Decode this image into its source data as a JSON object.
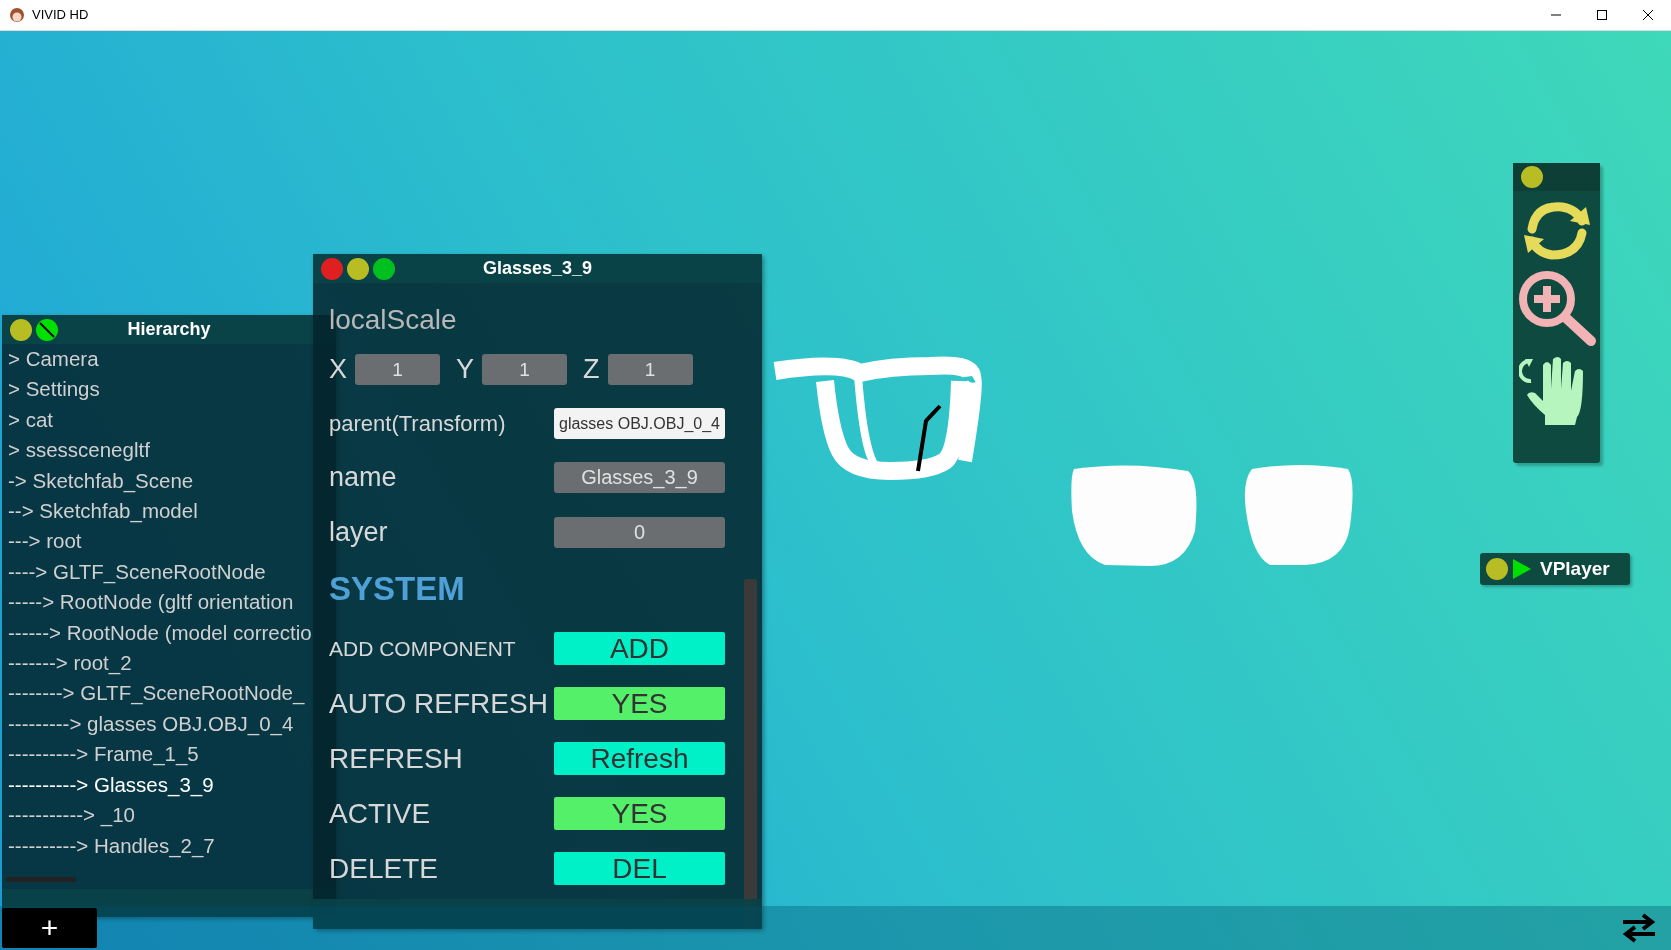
{
  "window": {
    "title": "VIVID HD"
  },
  "hierarchy": {
    "title": "Hierarchy",
    "items": [
      {
        "label": "> Camera",
        "selected": false
      },
      {
        "label": "> Settings",
        "selected": false
      },
      {
        "label": "> cat",
        "selected": false
      },
      {
        "label": "> ssesscenegltf",
        "selected": false
      },
      {
        "label": "-> Sketchfab_Scene",
        "selected": false
      },
      {
        "label": "--> Sketchfab_model",
        "selected": false
      },
      {
        "label": "---> root",
        "selected": false
      },
      {
        "label": "----> GLTF_SceneRootNode",
        "selected": false
      },
      {
        "label": "-----> RootNode (gltf orientation",
        "selected": false
      },
      {
        "label": "------> RootNode (model correctio",
        "selected": false
      },
      {
        "label": "-------> root_2",
        "selected": false
      },
      {
        "label": "--------> GLTF_SceneRootNode_",
        "selected": false
      },
      {
        "label": "---------> glasses OBJ.OBJ_0_4",
        "selected": false
      },
      {
        "label": "----------> Frame_1_5",
        "selected": false
      },
      {
        "label": "----------> Glasses_3_9",
        "selected": true
      },
      {
        "label": "-----------> _10",
        "selected": false
      },
      {
        "label": "----------> Handles_2_7",
        "selected": false
      }
    ]
  },
  "inspector": {
    "title": "Glasses_3_9",
    "section": "localScale",
    "scale": [
      {
        "axis": "X",
        "value": "1"
      },
      {
        "axis": "Y",
        "value": "1"
      },
      {
        "axis": "Z",
        "value": "1"
      }
    ],
    "fields": [
      {
        "label": "parent(Transform)",
        "value": "glasses OBJ.OBJ_0_4",
        "kind": "input"
      },
      {
        "label": "name",
        "value": "Glasses_3_9",
        "kind": "readonly"
      },
      {
        "label": "layer",
        "value": "0",
        "kind": "readonly"
      }
    ],
    "system_title": "SYSTEM",
    "actions": [
      {
        "label": "ADD COMPONENT",
        "button": "ADD",
        "kind": "action"
      },
      {
        "label": "AUTO REFRESH",
        "button": "YES",
        "kind": "toggle",
        "on": true
      },
      {
        "label": "REFRESH",
        "button": "Refresh",
        "kind": "action"
      },
      {
        "label": "ACTIVE",
        "button": "YES",
        "kind": "toggle",
        "on": true
      },
      {
        "label": "DELETE",
        "button": "DEL",
        "kind": "action"
      }
    ]
  },
  "player": {
    "label": "VPlayer"
  },
  "bottom_bar": {
    "add_button": "+"
  }
}
